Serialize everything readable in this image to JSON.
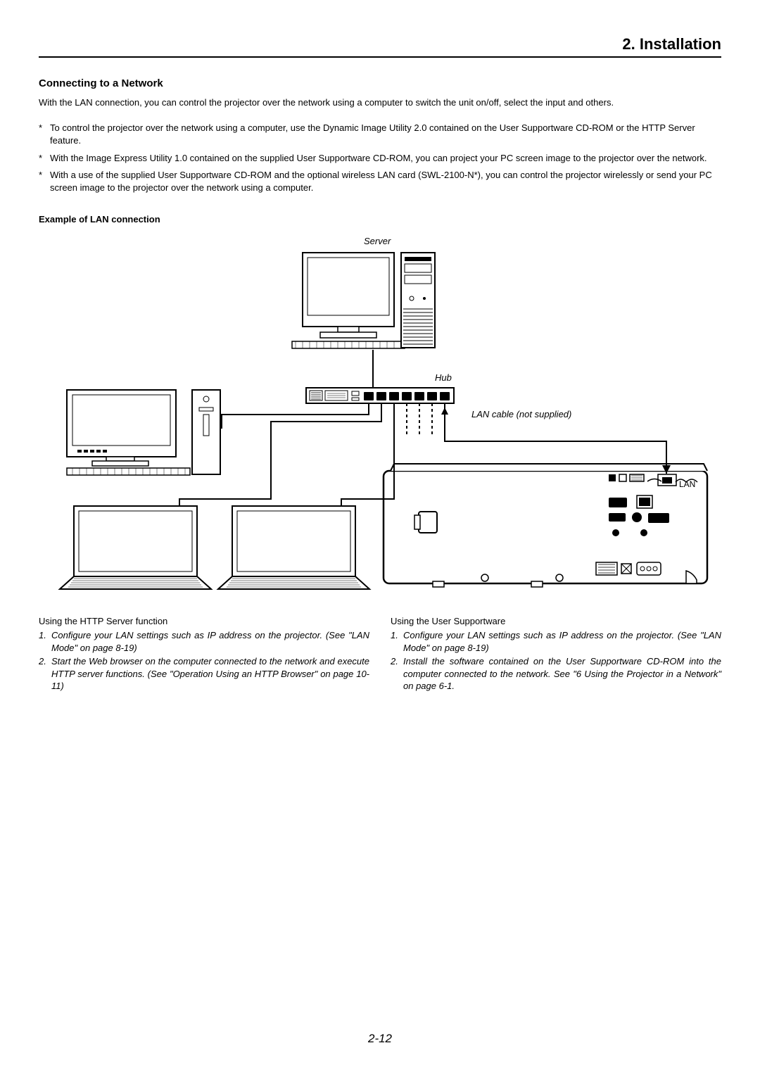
{
  "chapter": "2. Installation",
  "section_title": "Connecting to a Network",
  "intro": "With the LAN connection, you can control the projector over the network using a computer to switch the unit on/off, select the input and others.",
  "bullets": [
    "To control the projector over the network using a computer, use the Dynamic Image Utility 2.0 contained on the User Supportware CD-ROM or the HTTP Server feature.",
    "With the Image Express Utility 1.0 contained on the supplied User Supportware CD-ROM, you can project your PC screen image to the projector over the network.",
    "With a use of the supplied User Supportware CD-ROM and the optional wireless LAN card (SWL-2100-N*), you can control the projector wirelessly or send your PC screen image to the projector over the network using a computer."
  ],
  "subhead": "Example of LAN connection",
  "diagram": {
    "server": "Server",
    "hub": "Hub",
    "lan_cable": "LAN cable (not supplied)",
    "lan": "LAN"
  },
  "columns": {
    "left": {
      "head": "Using the HTTP Server function",
      "items": [
        "Configure your LAN settings such as IP address on the projector. (See \"LAN Mode\" on page 8-19)",
        "Start the Web browser on the computer connected to the network and execute HTTP server functions. (See \"Operation Using an HTTP Browser\" on page 10-11)"
      ]
    },
    "right": {
      "head": "Using the User Supportware",
      "items": [
        "Configure your LAN settings such as IP address on the projector. (See \"LAN Mode\" on page 8-19)",
        "Install the software contained on the User Supportware CD-ROM into the computer connected to the network. See \"6 Using the Projector in a Network\" on page 6-1."
      ]
    }
  },
  "page_number": "2-12"
}
